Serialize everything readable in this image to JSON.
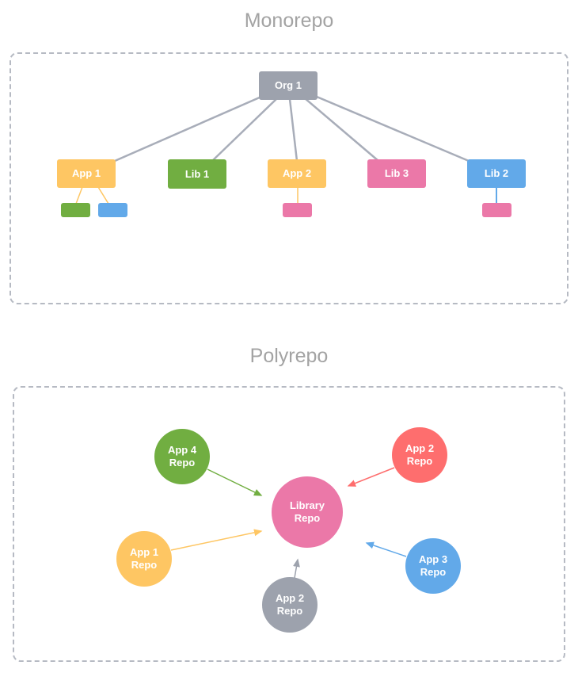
{
  "colors": {
    "gray": "#9da2ad",
    "orange": "#fec663",
    "green": "#71ae41",
    "pink": "#eb78a8",
    "blue": "#62a9e9",
    "red": "#fe6e6e",
    "edge": "#a8adb9",
    "title": "#a3a3a3"
  },
  "monorepo": {
    "title": "Monorepo",
    "root": {
      "label": "Org 1",
      "color": "gray"
    },
    "children": [
      {
        "label": "App 1",
        "color": "orange",
        "deps": [
          "green",
          "blue"
        ]
      },
      {
        "label": "Lib 1",
        "color": "green",
        "deps": []
      },
      {
        "label": "App 2",
        "color": "orange",
        "deps": [
          "pink"
        ]
      },
      {
        "label": "Lib 3",
        "color": "pink",
        "deps": []
      },
      {
        "label": "Lib 2",
        "color": "blue",
        "deps": [
          "pink"
        ]
      }
    ]
  },
  "polyrepo": {
    "title": "Polyrepo",
    "center": {
      "label_line1": "Library",
      "label_line2": "Repo",
      "color": "pink"
    },
    "repos": [
      {
        "label_line1": "App 4",
        "label_line2": "Repo",
        "color": "green"
      },
      {
        "label_line1": "App 2",
        "label_line2": "Repo",
        "color": "red"
      },
      {
        "label_line1": "App 1",
        "label_line2": "Repo",
        "color": "orange"
      },
      {
        "label_line1": "App 3",
        "label_line2": "Repo",
        "color": "blue"
      },
      {
        "label_line1": "App 2",
        "label_line2": "Repo",
        "color": "gray"
      }
    ]
  }
}
